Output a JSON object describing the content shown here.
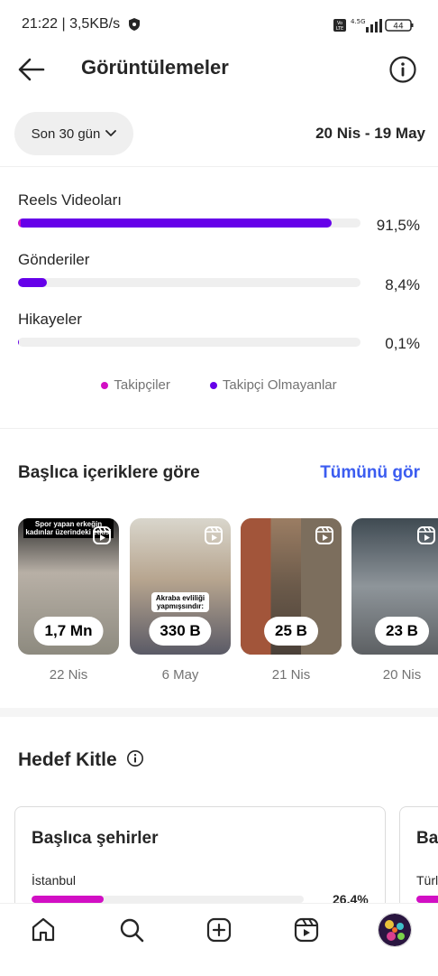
{
  "status_bar": {
    "time_speed": "21:22 | 3,5KB/s",
    "volte": "Vo LTE",
    "network": "4.5G",
    "battery": "44"
  },
  "header": {
    "title": "Görüntülemeler"
  },
  "range": {
    "period": "Son 30 gün",
    "dates": "20 Nis - 19 May"
  },
  "breakdown": [
    {
      "label": "Reels Videoları",
      "percent_text": "91,5%",
      "total": 0.915,
      "followers": 0.005
    },
    {
      "label": "Gönderiler",
      "percent_text": "8,4%",
      "total": 0.084,
      "followers": 0.0
    },
    {
      "label": "Hikayeler",
      "percent_text": "0,1%",
      "total": 0.001,
      "followers": 0.0
    }
  ],
  "legend": {
    "followers": "Takipçiler",
    "non_followers": "Takipçi Olmayanlar"
  },
  "colors": {
    "followers": "#d20fc4",
    "non_followers": "#6500e9",
    "link": "#3b5cf0"
  },
  "top_content": {
    "title": "Başlıca içeriklere göre",
    "see_all": "Tümünü gör",
    "items": [
      {
        "count": "1,7 Mn",
        "date": "22 Nis",
        "caption": "Spor yapan erkeğin kadınlar üzerindeki etkisi"
      },
      {
        "count": "330 B",
        "date": "6 May",
        "caption": "Akraba evliliği yapmışsındır:"
      },
      {
        "count": "25 B",
        "date": "21 Nis",
        "caption": ""
      },
      {
        "count": "23 B",
        "date": "20 Nis",
        "caption": ""
      }
    ]
  },
  "audience": {
    "title": "Hedef Kitle",
    "card_title": "Başlıca şehirler",
    "card2_title_partial": "Ba",
    "city": "İstanbul",
    "city_pct": "26,4%",
    "city_fraction": 0.264,
    "card2_city_partial": "Türl"
  },
  "nav": {
    "icons": [
      "home-icon",
      "search-icon",
      "create-icon",
      "reels-icon",
      "profile-avatar"
    ]
  }
}
